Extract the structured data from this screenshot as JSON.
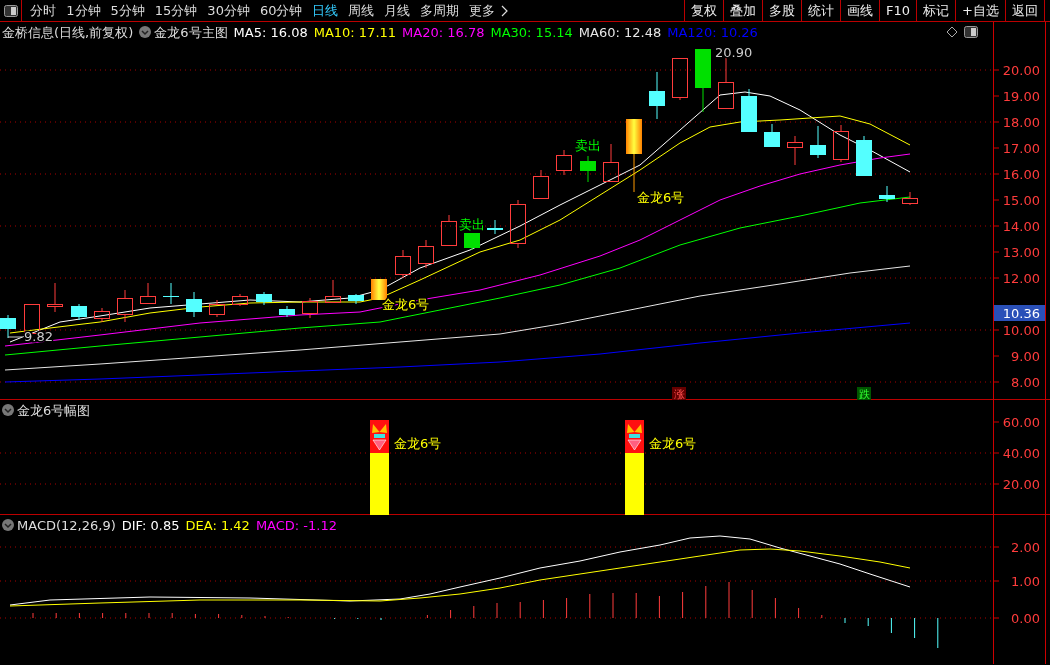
{
  "toolbar": {
    "periods": [
      {
        "label": "分时",
        "selected": false
      },
      {
        "label": "1分钟",
        "selected": false
      },
      {
        "label": "5分钟",
        "selected": false
      },
      {
        "label": "15分钟",
        "selected": false
      },
      {
        "label": "30分钟",
        "selected": false
      },
      {
        "label": "60分钟",
        "selected": false
      },
      {
        "label": "日线",
        "selected": true
      },
      {
        "label": "周线",
        "selected": false
      },
      {
        "label": "月线",
        "selected": false
      },
      {
        "label": "多周期",
        "selected": false
      },
      {
        "label": "更多",
        "selected": false
      }
    ],
    "buttons": [
      "复权",
      "叠加",
      "多股",
      "统计",
      "画线",
      "F10",
      "标记",
      "+自选",
      "返回"
    ]
  },
  "main_chart": {
    "title": "金桥信息(日线,前复权)",
    "indicator": "金龙6号主图",
    "moving_averages": [
      {
        "label": "MA5: 16.08",
        "color": "#ffffff"
      },
      {
        "label": "MA10: 17.11",
        "color": "#ffff00"
      },
      {
        "label": "MA20: 16.78",
        "color": "#ff00ff"
      },
      {
        "label": "MA30: 15.14",
        "color": "#00ff00"
      },
      {
        "label": "MA60: 12.48",
        "color": "#e6e6e6"
      },
      {
        "label": "MA120: 10.26",
        "color": "#0000ff"
      }
    ],
    "y_axis_labels": [
      "20.00",
      "19.00",
      "18.00",
      "17.00",
      "16.00",
      "15.00",
      "14.00",
      "13.00",
      "12.00",
      "10.00",
      "9.00",
      "8.00"
    ],
    "current_price": "10.36",
    "annotations": [
      {
        "kind": "signal",
        "text": "金龙6号"
      },
      {
        "kind": "sell",
        "text": "卖出"
      },
      {
        "kind": "sell",
        "text": "卖出"
      },
      {
        "kind": "signal",
        "text": "金龙6号"
      },
      {
        "kind": "high",
        "text": "20.90"
      },
      {
        "kind": "low",
        "text": "9.82"
      }
    ],
    "marks": [
      {
        "kind": "rise",
        "text": "涨"
      },
      {
        "kind": "fall",
        "text": "跌"
      }
    ]
  },
  "signal_pane": {
    "title": "金龙6号幅图",
    "y_axis_labels": [
      "60.00",
      "40.00",
      "20.00"
    ],
    "signals": [
      "金龙6号",
      "金龙6号"
    ]
  },
  "macd_pane": {
    "title": "MACD(12,26,9)",
    "values": [
      {
        "label": "DIF: 0.85",
        "color": "#ffffff"
      },
      {
        "label": "DEA: 1.42",
        "color": "#ffff00"
      },
      {
        "label": "MACD: -1.12",
        "color": "#ff00ff"
      }
    ],
    "y_axis_labels": [
      "2.00",
      "1.00",
      "0.00"
    ]
  }
}
